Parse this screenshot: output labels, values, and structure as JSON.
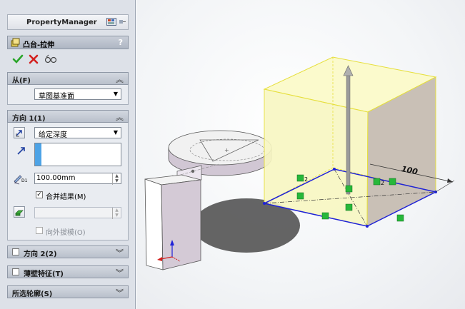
{
  "property_manager": {
    "title": "PropertyManager",
    "feature_name": "凸台-拉伸",
    "help_label": "?",
    "from_section": {
      "header": "从(F)",
      "start_condition": "草图基准面"
    },
    "direction1": {
      "header": "方向 1(1)",
      "end_condition": "给定深度",
      "depth": "100.00mm",
      "merge_result_label": "合并结果(M)",
      "merge_result_checked": true,
      "draft_outward_label": "向外拔模(O)",
      "depth_symbol": "D1"
    },
    "direction2_header": "方向 2(2)",
    "thin_feature_header": "薄壁特征(T)",
    "selected_contours_header": "所选轮廓(S)"
  },
  "viewport": {
    "dimension_label": "100",
    "sketch_relation_2a": "2",
    "sketch_relation_2b": "2",
    "colors": {
      "preview_fill": "#f8f7c2",
      "preview_edge": "#e6df3c",
      "sketch_blue": "#1f22d8",
      "relation_green": "#27b83a",
      "part_gray": "#d4cad6"
    }
  }
}
